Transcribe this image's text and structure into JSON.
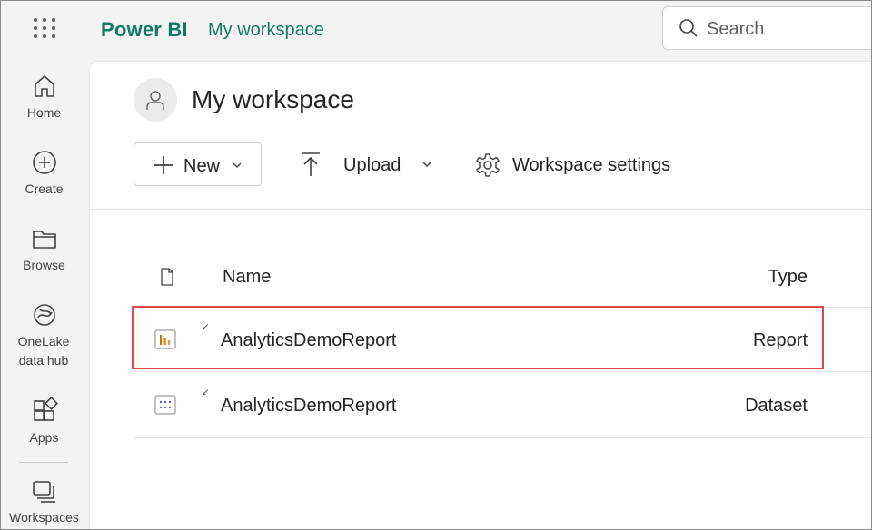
{
  "app": {
    "brand": "Power BI",
    "breadcrumb": "My workspace"
  },
  "search": {
    "placeholder": "Search"
  },
  "nav": [
    {
      "label": "Home",
      "icon": "home-icon"
    },
    {
      "label": "Create",
      "icon": "create-icon"
    },
    {
      "label": "Browse",
      "icon": "folder-icon"
    },
    {
      "label": "OneLake data hub",
      "icon": "onelake-icon"
    },
    {
      "label": "Apps",
      "icon": "apps-icon"
    },
    {
      "label": "Workspaces",
      "icon": "workspaces-icon"
    }
  ],
  "workspace": {
    "title": "My workspace"
  },
  "toolbar": {
    "new_label": "New",
    "upload_label": "Upload",
    "settings_label": "Workspace settings"
  },
  "table": {
    "columns": {
      "name": "Name",
      "type": "Type"
    },
    "rows": [
      {
        "name": "AnalyticsDemoReport",
        "type": "Report",
        "icon": "report-icon",
        "highlighted": true
      },
      {
        "name": "AnalyticsDemoReport",
        "type": "Dataset",
        "icon": "dataset-icon",
        "highlighted": false
      }
    ]
  },
  "colors": {
    "brand": "#117865",
    "highlight": "#e04a4f",
    "report_icon": "#c27a0e",
    "dataset_icon": "#5b5fc7"
  }
}
